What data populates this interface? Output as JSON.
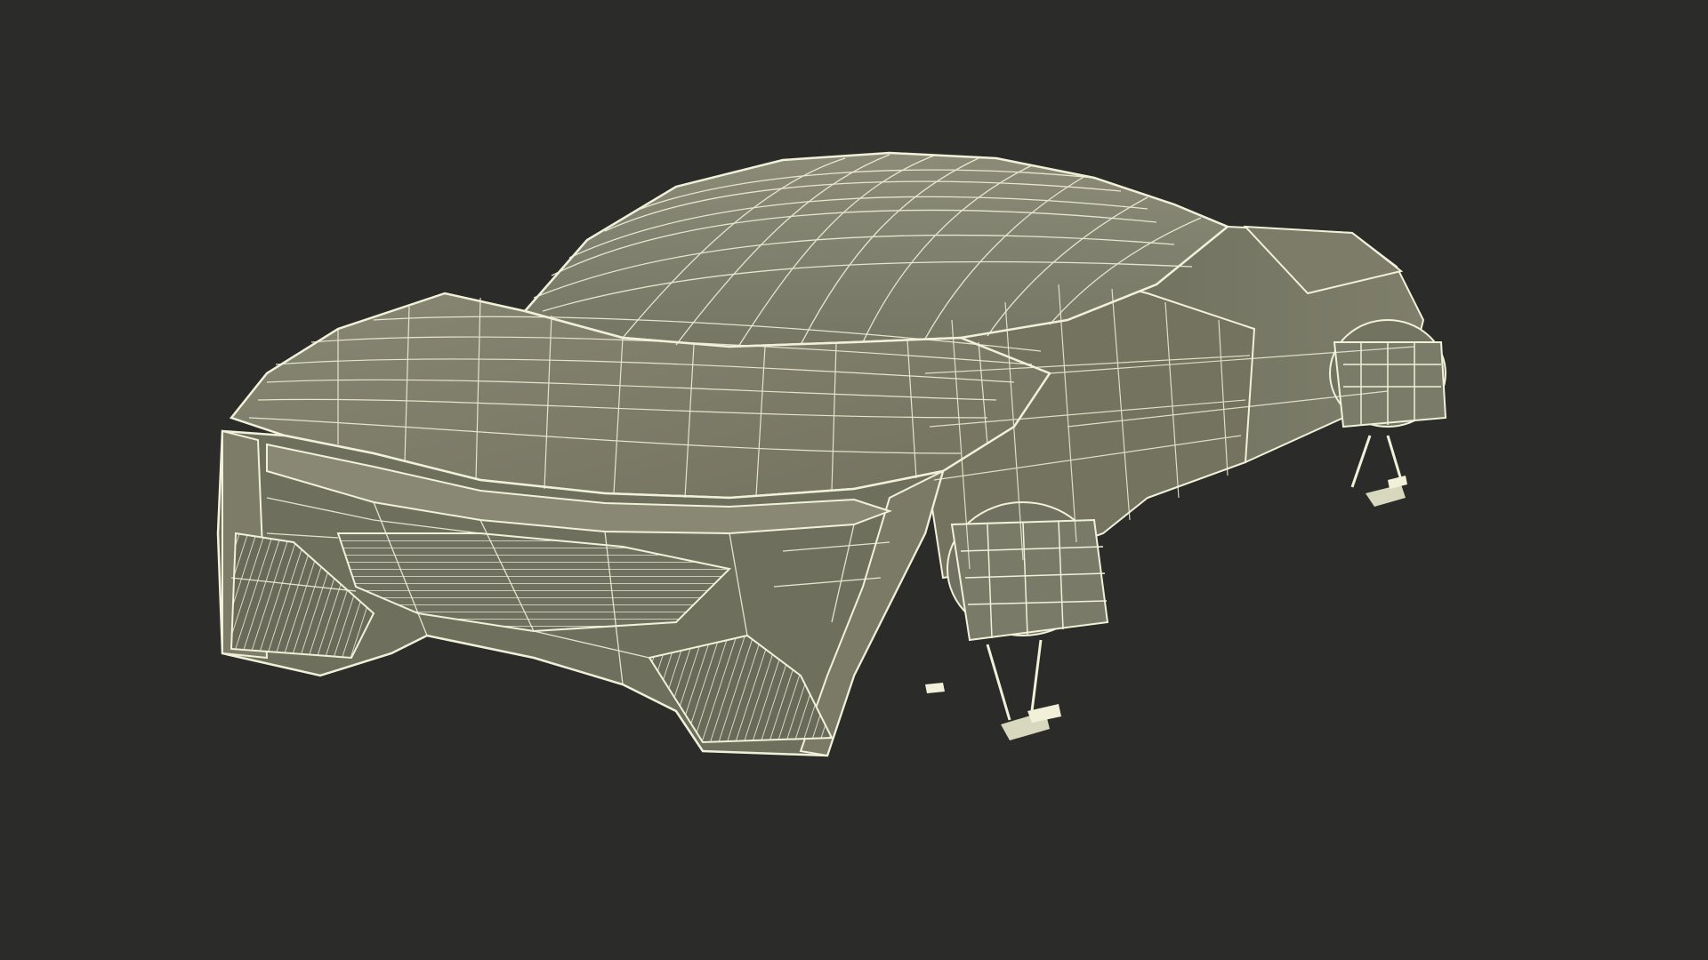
{
  "scene": {
    "subject": "wireframe-flying-car",
    "colors": {
      "background": "#2b2b2a",
      "surface": "#7f7f6d",
      "surface_dark": "#6a6a5a",
      "surface_light": "#8c8c78",
      "wire": "#f1f1d9",
      "wire_soft": "#d8d8bf",
      "shadow": "#3a3a33"
    }
  }
}
